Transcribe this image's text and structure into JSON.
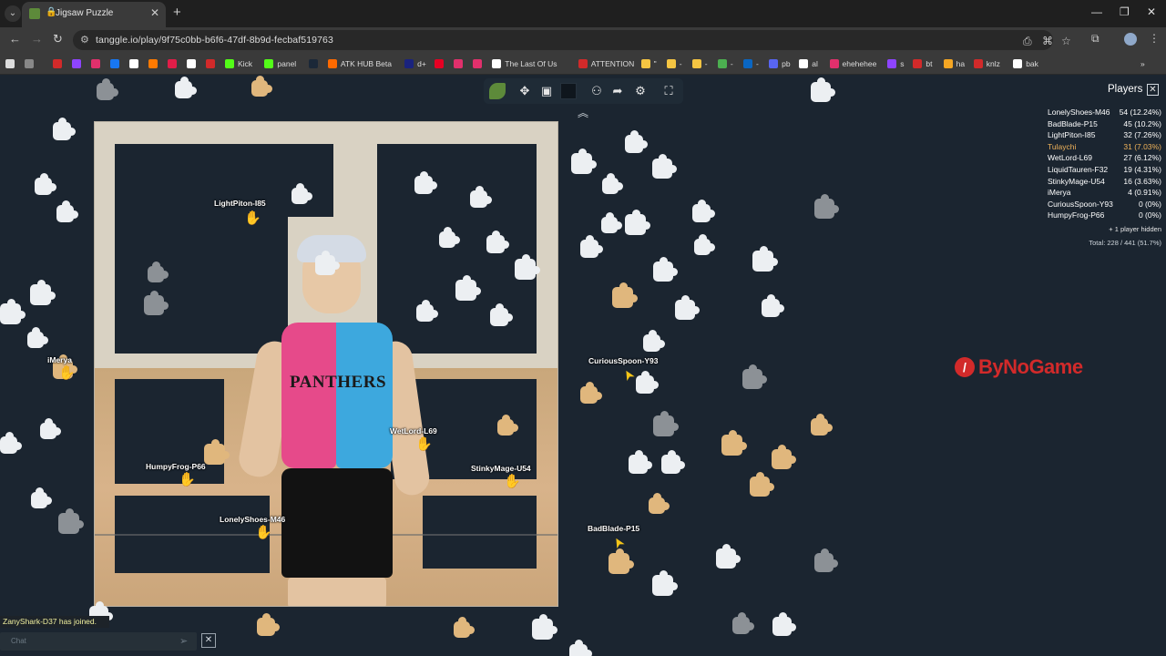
{
  "browser": {
    "tab_title": "Jigsaw Puzzle",
    "url": "tanggle.io/play/9f75c0bb-b6f6-47df-8b9d-fecbaf519763",
    "bookmarks": [
      {
        "label": "",
        "color": "#d22a2a"
      },
      {
        "label": "",
        "color": "#8e44ff"
      },
      {
        "label": "",
        "color": "#e1306c"
      },
      {
        "label": "",
        "color": "#1877f2"
      },
      {
        "label": "",
        "color": "#ffffff"
      },
      {
        "label": "",
        "color": "#ff7a00"
      },
      {
        "label": "",
        "color": "#e11d48"
      },
      {
        "label": "",
        "color": "#ffffff"
      },
      {
        "label": "",
        "color": "#d22a2a"
      },
      {
        "label": "Kick",
        "color": "#53fc18"
      },
      {
        "label": "panel",
        "color": "#53fc18"
      },
      {
        "label": "",
        "color": "#1b2838"
      },
      {
        "label": "ATK HUB Beta",
        "color": "#ff6a00"
      },
      {
        "label": "d+",
        "color": "#1a237e"
      },
      {
        "label": "",
        "color": "#e60023"
      },
      {
        "label": "",
        "color": "#e1306c"
      },
      {
        "label": "",
        "color": "#e1306c"
      },
      {
        "label": "The Last Of Us",
        "color": "#ffffff"
      },
      {
        "label": "ATTENTION",
        "color": "#d22a2a"
      },
      {
        "label": "\"",
        "color": "#f5c542"
      },
      {
        "label": "-",
        "color": "#f5c542"
      },
      {
        "label": "-",
        "color": "#f5c542"
      },
      {
        "label": "-",
        "color": "#4caf50"
      },
      {
        "label": "-",
        "color": "#0a66c2"
      },
      {
        "label": "pb",
        "color": "#5865f2"
      },
      {
        "label": "al",
        "color": "#ffffff"
      },
      {
        "label": "ehehehee",
        "color": "#e1306c"
      },
      {
        "label": "s",
        "color": "#8e44ff"
      },
      {
        "label": "bt",
        "color": "#d22a2a"
      },
      {
        "label": "ha",
        "color": "#f5a623"
      },
      {
        "label": "knlz",
        "color": "#d22a2a"
      },
      {
        "label": "bak",
        "color": "#ffffff"
      }
    ]
  },
  "players_panel": {
    "title": "Players",
    "rows": [
      {
        "name": "LonelyShoes-M46",
        "score": "54 (12.24%)",
        "is_me": false
      },
      {
        "name": "BadBlade-P15",
        "score": "45 (10.2%)",
        "is_me": false
      },
      {
        "name": "LightPiton-I85",
        "score": "32 (7.26%)",
        "is_me": false
      },
      {
        "name": "Tulaychi",
        "score": "31 (7.03%)",
        "is_me": true
      },
      {
        "name": "WetLord-L69",
        "score": "27 (6.12%)",
        "is_me": false
      },
      {
        "name": "LiquidTauren-F32",
        "score": "19 (4.31%)",
        "is_me": false
      },
      {
        "name": "StinkyMage-U54",
        "score": "16 (3.63%)",
        "is_me": false
      },
      {
        "name": "iMerya",
        "score": "4 (0.91%)",
        "is_me": false
      },
      {
        "name": "CuriousSpoon-Y93",
        "score": "0 (0%)",
        "is_me": false
      },
      {
        "name": "HumpyFrog-P66",
        "score": "0 (0%)",
        "is_me": false
      }
    ],
    "hidden_note": "+ 1 player hidden",
    "total": "Total: 228 / 441 (51.7%)"
  },
  "cursors": [
    {
      "name": "LightPiton-I85",
      "kind": "hand-icon",
      "color": "#f5c518"
    },
    {
      "name": "iMerya",
      "kind": "hand-icon",
      "color": "#c0392b"
    },
    {
      "name": "CuriousSpoon-Y93",
      "kind": "arrow-icon",
      "color": "#f5c518"
    },
    {
      "name": "WetLord-L69",
      "kind": "hand-icon",
      "color": "#f5c518"
    },
    {
      "name": "HumpyFrog-P66",
      "kind": "hand-icon",
      "color": "#f5c518"
    },
    {
      "name": "StinkyMage-U54",
      "kind": "hand-icon",
      "color": "#f5c518"
    },
    {
      "name": "LonelyShoes-M46",
      "kind": "hand-icon",
      "color": "#f5c518"
    },
    {
      "name": "BadBlade-P15",
      "kind": "arrow-icon",
      "color": "#f5c518"
    }
  ],
  "puzzle_image": {
    "jersey_text": "PANTHERS"
  },
  "watermark": {
    "text": "ByNoGame"
  },
  "chat": {
    "toast": "ZanyShark-D37 has joined.",
    "placeholder": "Chat"
  },
  "colors": {
    "background": "#1b2530",
    "accent_me": "#f0b35a",
    "logo_green": "#5d8a3a"
  }
}
